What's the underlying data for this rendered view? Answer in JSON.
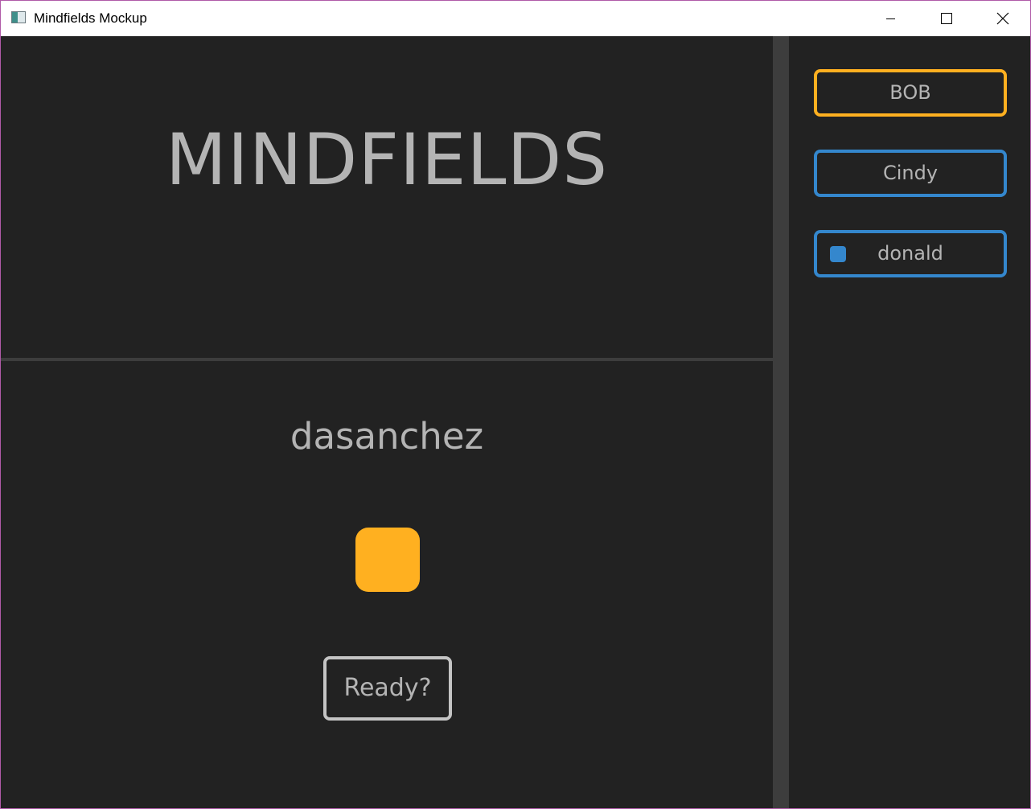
{
  "window": {
    "title": "Mindfields Mockup",
    "icon": "app-window-icon",
    "controls": [
      "minimize-icon",
      "maximize-icon",
      "close-icon"
    ]
  },
  "colors": {
    "background": "#222222",
    "splitter": "#3d3d3d",
    "text": "#b4b4b4",
    "orange": "#ffb020",
    "blue": "#3487cd",
    "gray_border": "#c4c4c4"
  },
  "main": {
    "title": "MINDFIELDS",
    "username": "dasanchez",
    "player_color": "#ffb020",
    "ready_label": "Ready?"
  },
  "players": [
    {
      "name": "BOB",
      "border_color": "#ffb020",
      "indicator": false
    },
    {
      "name": "Cindy",
      "border_color": "#3487cd",
      "indicator": false
    },
    {
      "name": "donald",
      "border_color": "#3487cd",
      "indicator": true,
      "indicator_color": "#3487cd"
    }
  ]
}
